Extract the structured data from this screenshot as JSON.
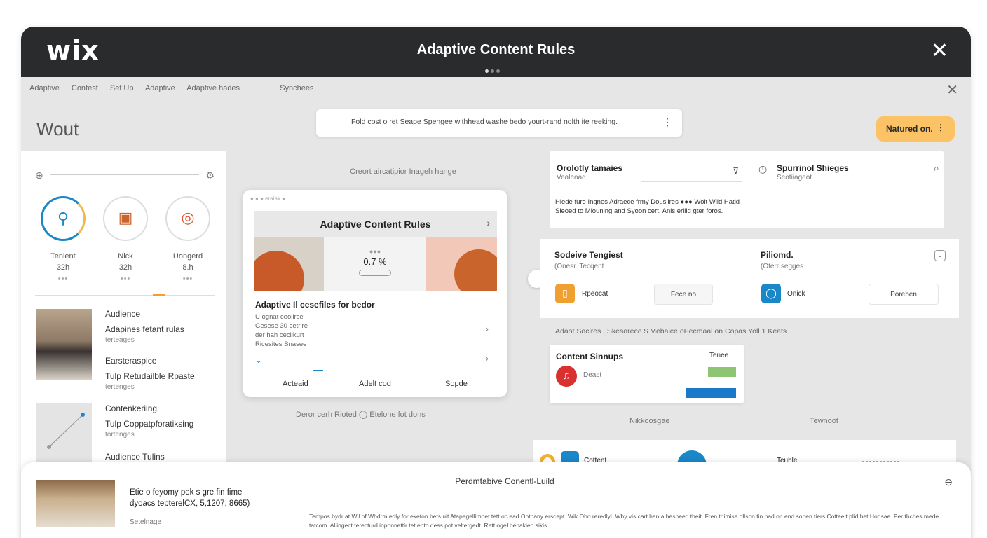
{
  "header": {
    "logo": "wix",
    "title": "Adaptive Content Rules",
    "close": "✕"
  },
  "subnav": {
    "items": [
      "Adaptive",
      "Contest",
      "Set Up",
      "Adaptive",
      "Adaptive hades"
    ],
    "extra": "Synchees",
    "close": "✕"
  },
  "page_title": "Wout",
  "search_banner": "Fold cost o ret Seape Spengee withhead washe bedo yourt-rand nolth ite reeking.",
  "primary_button": "Natured on.",
  "left": {
    "stats": [
      {
        "label": "Tenlent",
        "value": "32h",
        "icon": "⚲"
      },
      {
        "label": "Nick",
        "value": "32h",
        "icon": "▣"
      },
      {
        "label": "Uongerd",
        "value": "8.h",
        "icon": "◎"
      }
    ],
    "items": [
      {
        "title": "Audience",
        "subtitle": "Adapines fetant rulas",
        "meta": "terteages"
      },
      {
        "title": "Earsteraspice",
        "subtitle": "Tulp Retudailble Rpaste",
        "meta": "tertenges"
      },
      {
        "title": "Contenkeriing",
        "subtitle": "Tulp Coppatpforatiksing",
        "meta": "tortenges"
      },
      {
        "title": "Audience Tulins"
      }
    ]
  },
  "center": {
    "caption": "Creort aircatipior Inageh hange",
    "card": {
      "toolbar": "● ● ● eraiak ●",
      "hero_title": "Adaptive Content Rules",
      "hero_value": "0.7 %",
      "subtitle": "Adaptive Il cesefiles for bedor",
      "lines": [
        "U ognat ceoiirce",
        "Gesese 30 cetrire",
        "der hah ceciikurt",
        "Ricesites Snasee"
      ],
      "tabs": [
        "Acteaid",
        "Adelt cod",
        "Sopde"
      ]
    },
    "below": "Deror cerh Rioted      ◯      Etelone fot dons"
  },
  "right": {
    "card1": {
      "left_title": "Orolotly tamaies",
      "left_sub": "Vealeoad",
      "right_title": "Spurrinol Shieges",
      "right_sub": "Seotiiageot",
      "body": "Hiede fure Ingnes Adraece frmy Douslires ●●● Woit Wild Hatid Sleoed to Miouning and Syoon cert. Anis erlild gter foros."
    },
    "card2": {
      "left_title": "Sodeive Tengiest",
      "left_sub": "(Onesr. Tecqent",
      "right_title": "Piliomd.",
      "right_sub": "(Oterr segges",
      "btn1_label": "Rpeocat",
      "btn1": "Fece no",
      "btn2_label": "Onick",
      "btn2": "Poreben"
    },
    "line": "Adaot Socires | Skesorece     $     Mebaice oPecmaal on Copas Yoll     1 Keats",
    "card3": {
      "title": "Content Sinnups",
      "right": "Tenee",
      "row": "Deast"
    },
    "labels": [
      "Nikkoosgae",
      "Tewnoot"
    ],
    "card4": {
      "left": "Cottent",
      "right": "Teuhle"
    }
  },
  "bottom": {
    "title": "Etie o feyomy pek s gre fin fime",
    "title2": "dyoacs tepterelCX, 5,1207, 8665)",
    "sub": "Setelnage",
    "center": "Perdmtabive Conentl-Luild",
    "text": "Tempos bydr at Wil of Whdrm edly for eketon bets uit Atapegellimpet tett oc ead Onthany erscept. Wik Obo reredlyl. Why vis cart han a hesheed theit. Fren thimise ollson tin had on end sopen tiers Cotteeit plid het Hoqsae. Per thches mede tatcom. Allingect terecturd inponnettir tet ento dess pot veltergedt. Rett ogel behakien sikis."
  },
  "colors": {
    "header_bg": "#2a2b2d",
    "accent_orange": "#fbc366",
    "accent_blue": "#1a87c9"
  }
}
